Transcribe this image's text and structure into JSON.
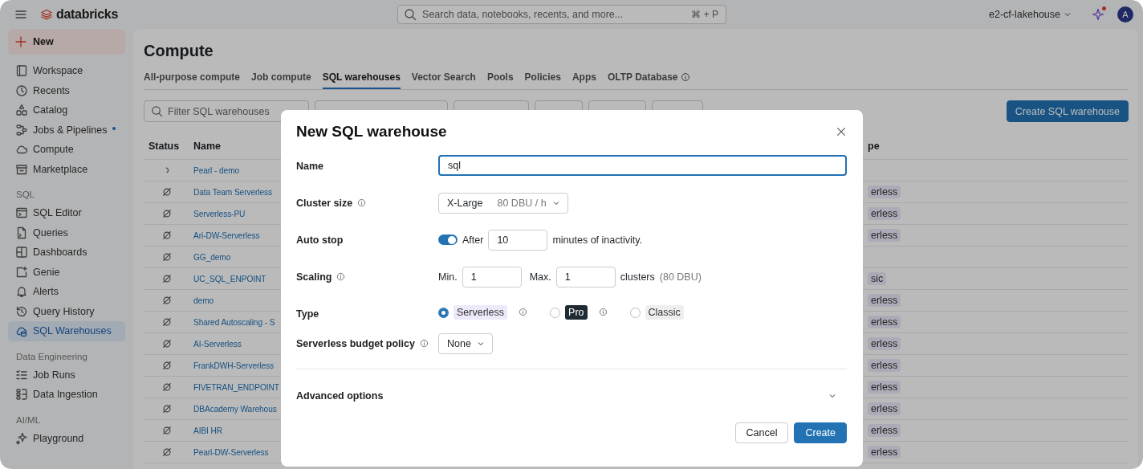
{
  "topbar": {
    "logo": "databricks",
    "search": {
      "placeholder": "Search data, notebooks, recents, and more...",
      "shortcut": "⌘ + P"
    },
    "workspace": "e2-cf-lakehouse",
    "notification_dot": true,
    "avatar": "A"
  },
  "sidebar": {
    "new_button": "New",
    "sections": [
      {
        "items": [
          {
            "label": "Workspace",
            "selected": false,
            "dot": false
          },
          {
            "label": "Recents",
            "selected": false,
            "dot": false
          },
          {
            "label": "Catalog",
            "selected": false,
            "dot": false
          },
          {
            "label": "Jobs & Pipelines",
            "selected": false,
            "dot": true
          },
          {
            "label": "Compute",
            "selected": false,
            "dot": false
          },
          {
            "label": "Marketplace",
            "selected": false,
            "dot": false
          }
        ]
      },
      {
        "heading": "SQL",
        "items": [
          {
            "label": "SQL Editor",
            "selected": false,
            "dot": false
          },
          {
            "label": "Queries",
            "selected": false,
            "dot": false
          },
          {
            "label": "Dashboards",
            "selected": false,
            "dot": false
          },
          {
            "label": "Genie",
            "selected": false,
            "dot": false
          },
          {
            "label": "Alerts",
            "selected": false,
            "dot": false
          },
          {
            "label": "Query History",
            "selected": false,
            "dot": false
          },
          {
            "label": "SQL Warehouses",
            "selected": true,
            "dot": false
          }
        ]
      },
      {
        "heading": "Data Engineering",
        "items": [
          {
            "label": "Job Runs",
            "selected": false,
            "dot": false
          },
          {
            "label": "Data Ingestion",
            "selected": false,
            "dot": false
          }
        ]
      },
      {
        "heading": "AI/ML",
        "items": [
          {
            "label": "Playground",
            "selected": false,
            "dot": false
          }
        ]
      }
    ]
  },
  "page": {
    "title": "Compute",
    "tabs": [
      {
        "label": "All-purpose compute",
        "selected": false,
        "info": false
      },
      {
        "label": "Job compute",
        "selected": false,
        "info": false
      },
      {
        "label": "SQL warehouses",
        "selected": true,
        "info": false
      },
      {
        "label": "Vector Search",
        "selected": false,
        "info": false
      },
      {
        "label": "Pools",
        "selected": false,
        "info": false
      },
      {
        "label": "Policies",
        "selected": false,
        "info": false
      },
      {
        "label": "Apps",
        "selected": false,
        "info": false
      },
      {
        "label": "OLTP Database",
        "selected": false,
        "info": true
      }
    ],
    "filter": {
      "placeholder": "Filter SQL warehouses"
    },
    "create_button": "Create SQL warehouse",
    "table": {
      "columns": [
        "Status",
        "Name",
        "pe"
      ],
      "rows": [
        {
          "kind": "starting",
          "name": "Pearl - demo"
        },
        {
          "kind": "stopped",
          "name": "Data Team Serverless",
          "type": "erless"
        },
        {
          "kind": "stopped",
          "name": "Serverless-PU",
          "type": "erless"
        },
        {
          "kind": "stopped",
          "name": "Ari-DW-Serverless",
          "type": "erless"
        },
        {
          "kind": "stopped",
          "name": "GG_demo"
        },
        {
          "kind": "stopped",
          "name": "UC_SQL_ENPOINT",
          "type": "sic"
        },
        {
          "kind": "stopped",
          "name": "demo",
          "type": "erless"
        },
        {
          "kind": "stopped",
          "name": "Shared Autoscaling - S",
          "type": "erless"
        },
        {
          "kind": "stopped",
          "name": "AI-Serverless",
          "type": "erless"
        },
        {
          "kind": "stopped",
          "name": "FrankDWH-Serverless",
          "type": "erless"
        },
        {
          "kind": "stopped",
          "name": "FIVETRAN_ENDPOINT",
          "type": "erless"
        },
        {
          "kind": "stopped",
          "name": "DBAcademy Warehous",
          "type": "erless"
        },
        {
          "kind": "stopped",
          "name": "AIBI HR",
          "type": "erless"
        },
        {
          "kind": "stopped",
          "name": "Pearl-DW-Serverless",
          "type": "erless"
        }
      ]
    }
  },
  "dialog": {
    "title": "New SQL warehouse",
    "name": {
      "label": "Name",
      "value": "sql"
    },
    "cluster_size": {
      "label": "Cluster size",
      "value": "X-Large",
      "detail": "80 DBU / h"
    },
    "auto_stop": {
      "label": "Auto stop",
      "on": true,
      "prefix": "After",
      "value": "10",
      "suffix": "minutes of inactivity."
    },
    "scaling": {
      "label": "Scaling",
      "min_label": "Min.",
      "min": "1",
      "max_label": "Max.",
      "max": "1",
      "unit": "clusters",
      "detail": "(80 DBU)"
    },
    "type": {
      "label": "Type",
      "options": [
        {
          "label": "Serverless",
          "selected": true,
          "info": true,
          "color": "#ece9fa"
        },
        {
          "label": "Pro",
          "selected": false,
          "info": true,
          "color": "#1f2a33"
        },
        {
          "label": "Classic",
          "selected": false,
          "info": false,
          "color": "#eeeeee"
        }
      ]
    },
    "budget_policy": {
      "label": "Serverless budget policy",
      "value": "None"
    },
    "advanced": {
      "label": "Advanced options",
      "expanded": false
    },
    "buttons": [
      {
        "label": "Cancel",
        "kind": "secondary"
      },
      {
        "label": "Create",
        "kind": "primary"
      }
    ]
  }
}
